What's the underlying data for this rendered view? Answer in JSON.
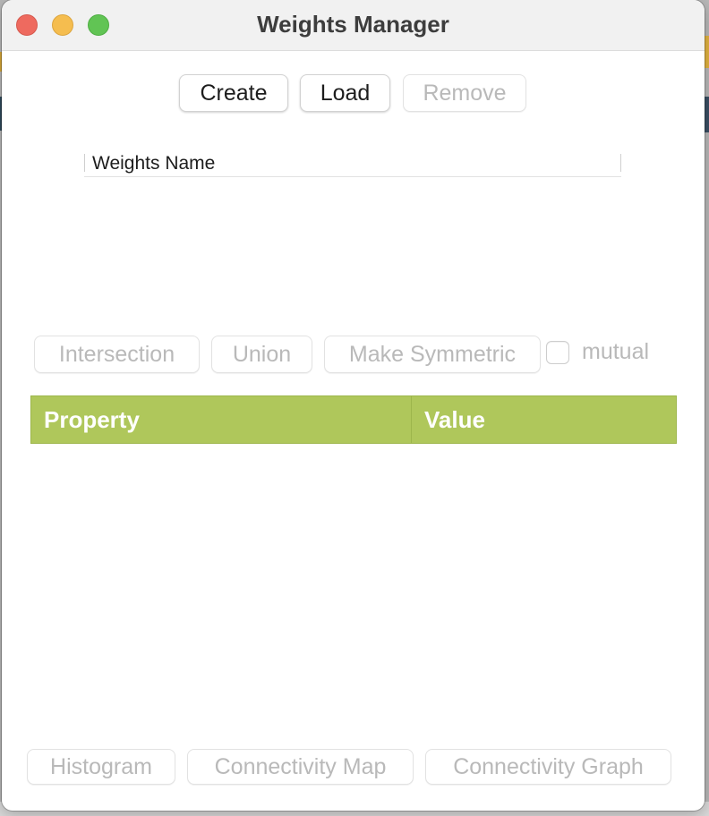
{
  "window": {
    "title": "Weights Manager"
  },
  "toolbar": {
    "create_label": "Create",
    "load_label": "Load",
    "remove_label": "Remove"
  },
  "weights_list": {
    "column_header": "Weights Name",
    "items": []
  },
  "operations": {
    "intersection_label": "Intersection",
    "union_label": "Union",
    "make_symmetric_label": "Make Symmetric",
    "mutual_label": "mutual",
    "mutual_checked": false
  },
  "properties_table": {
    "columns": [
      "Property",
      "Value"
    ],
    "header_color": "#afc75b",
    "rows": []
  },
  "bottom_actions": {
    "histogram_label": "Histogram",
    "connectivity_map_label": "Connectivity Map",
    "connectivity_graph_label": "Connectivity Graph"
  }
}
